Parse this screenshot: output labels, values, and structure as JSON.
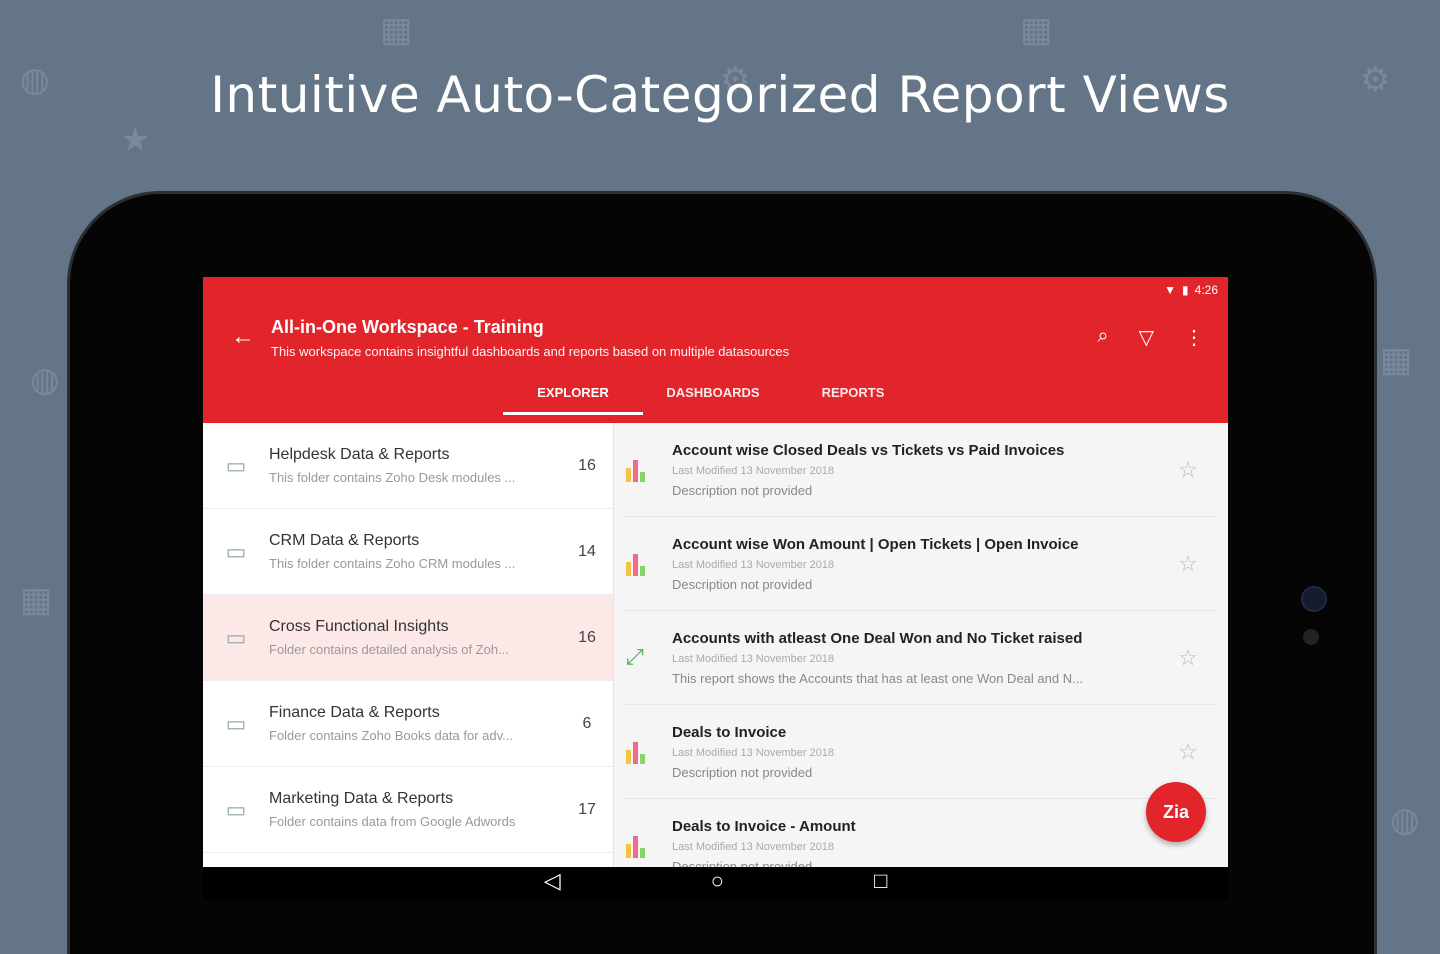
{
  "headline": "Intuitive Auto-Categorized Report Views",
  "status": {
    "time": "4:26"
  },
  "appbar": {
    "title": "All-in-One Workspace - Training",
    "subtitle": "This workspace contains insightful dashboards and reports based on multiple datasources"
  },
  "tabs": [
    {
      "label": "EXPLORER"
    },
    {
      "label": "DASHBOARDS"
    },
    {
      "label": "REPORTS"
    }
  ],
  "folders": [
    {
      "name": "Helpdesk Data & Reports",
      "desc": "This folder contains Zoho Desk modules ...",
      "count": "16"
    },
    {
      "name": "CRM Data & Reports",
      "desc": "This folder contains Zoho CRM modules ...",
      "count": "14"
    },
    {
      "name": "Cross Functional Insights",
      "desc": "Folder contains detailed analysis of Zoh...",
      "count": "16"
    },
    {
      "name": "Finance Data & Reports",
      "desc": "Folder contains Zoho Books data for adv...",
      "count": "6"
    },
    {
      "name": "Marketing Data & Reports",
      "desc": "Folder contains data from Google Adwords",
      "count": "17"
    }
  ],
  "reports": [
    {
      "title": "Account wise Closed Deals vs Tickets vs Paid Invoices",
      "modified": "Last Modified 13 November 2018",
      "desc": "Description not provided"
    },
    {
      "title": "Account wise Won Amount | Open Tickets | Open Invoice",
      "modified": "Last Modified 13 November 2018",
      "desc": "Description not provided"
    },
    {
      "title": "Accounts with atleast One Deal Won and No Ticket raised",
      "modified": "Last Modified 13 November 2018",
      "desc": "This report shows the Accounts that has at least one Won Deal and N..."
    },
    {
      "title": "Deals to Invoice",
      "modified": "Last Modified 13 November 2018",
      "desc": "Description not provided"
    },
    {
      "title": "Deals to Invoice - Amount",
      "modified": "Last Modified 13 November 2018",
      "desc": "Description not provided"
    }
  ],
  "colors": {
    "accent": "#e2242b",
    "background": "#647588"
  }
}
